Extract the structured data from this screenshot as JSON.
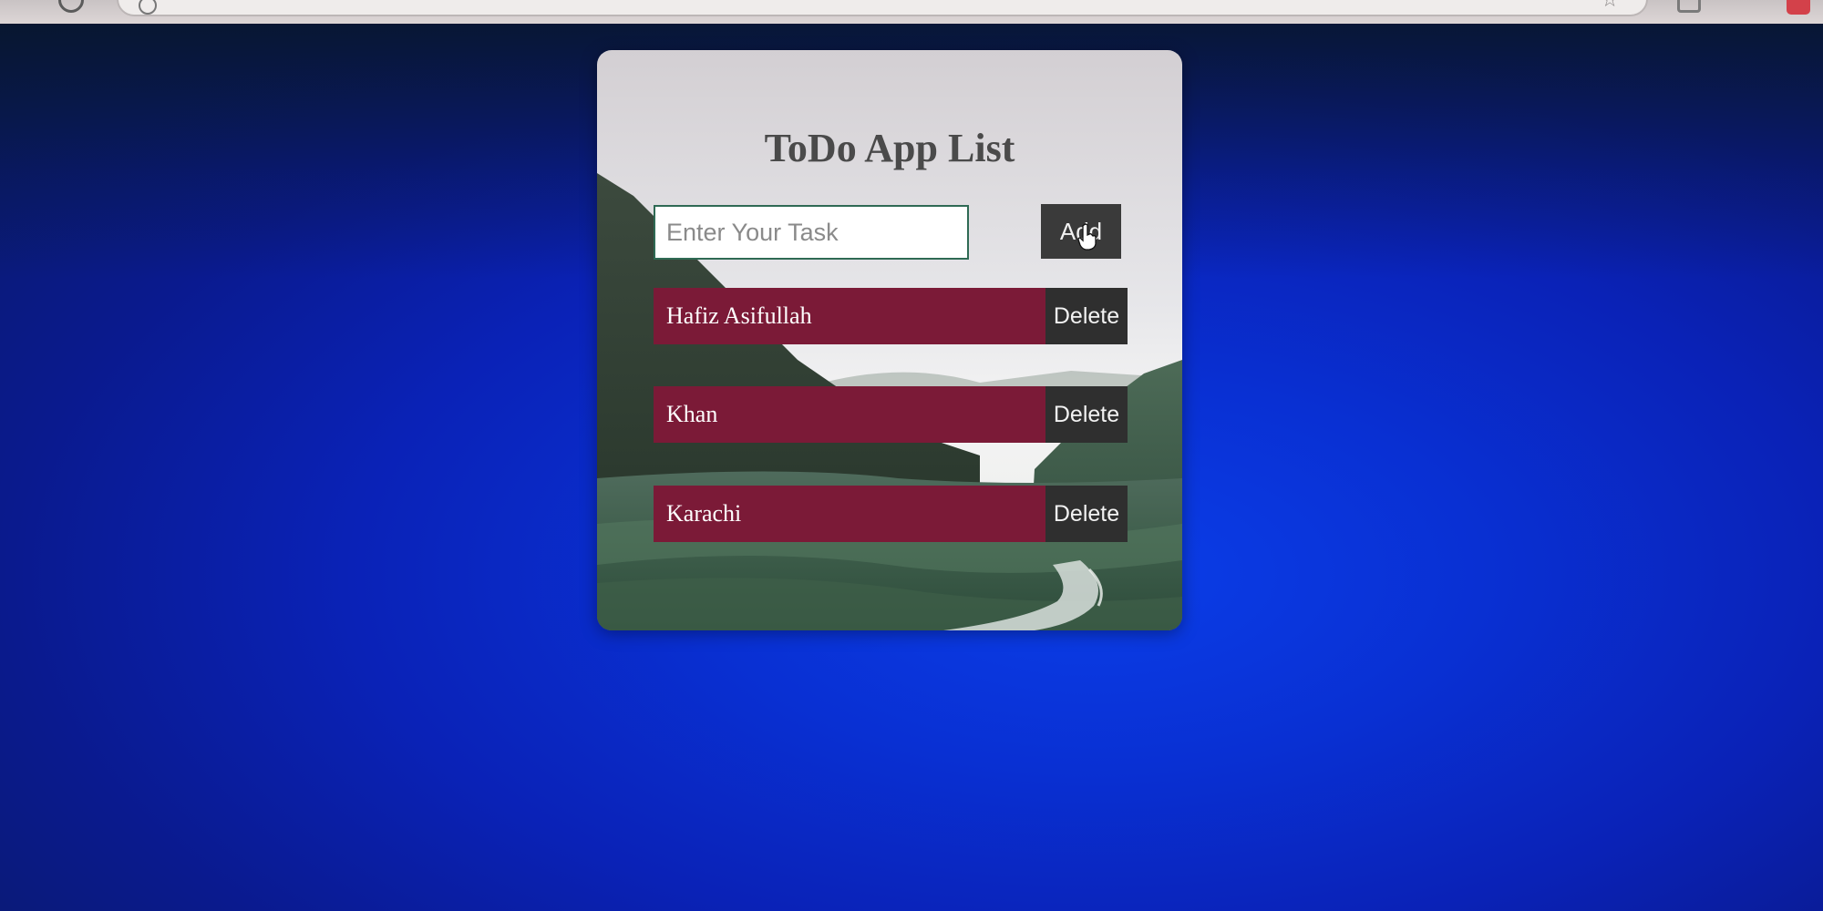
{
  "app": {
    "title": "ToDo App List",
    "input": {
      "placeholder": "Enter Your Task",
      "value": ""
    },
    "add_label": "Add",
    "delete_label": "Delete",
    "tasks": [
      {
        "text": "Hafiz Asifullah"
      },
      {
        "text": "Khan"
      },
      {
        "text": "Karachi"
      }
    ]
  },
  "colors": {
    "task_row": "#7b1a37",
    "button": "#3a3a3a",
    "page_background": "#0a22b7",
    "title_text": "#4a4a4a"
  },
  "icons": {
    "cursor": "hand-pointer-icon",
    "bookmark": "star-icon",
    "site_info": "info-icon"
  }
}
